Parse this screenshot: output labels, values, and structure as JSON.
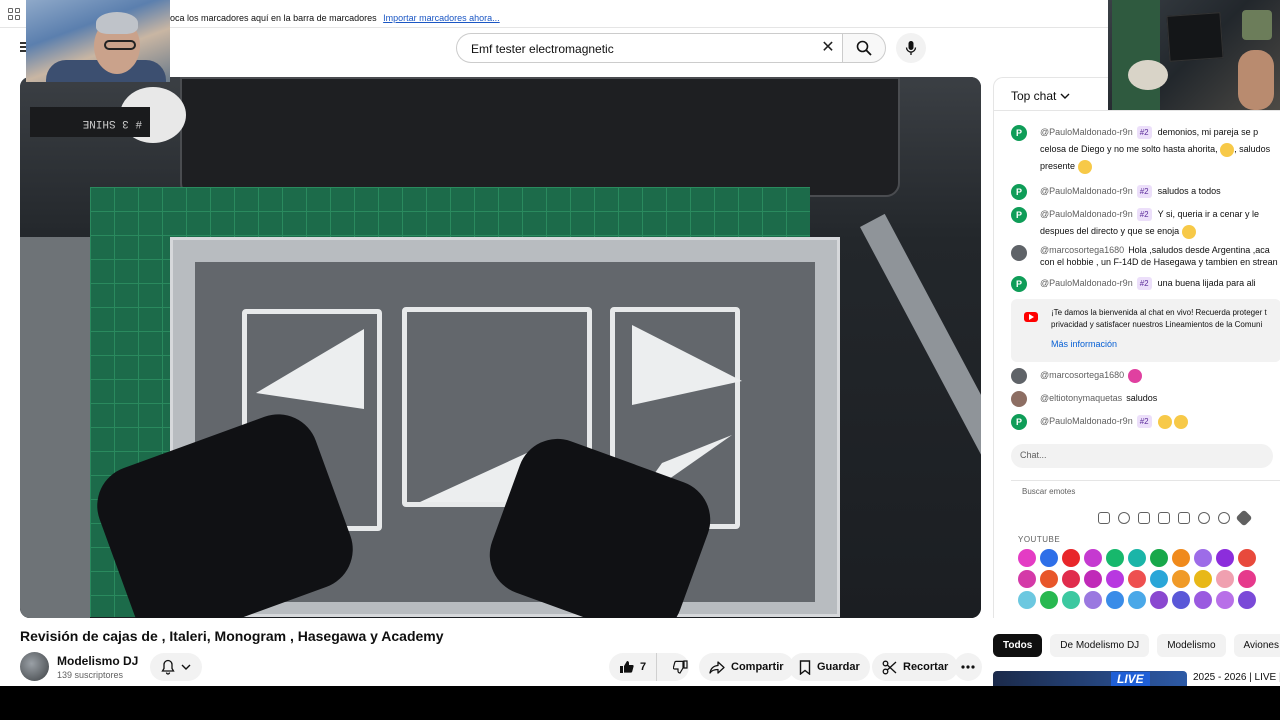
{
  "bookmarks_bar": {
    "message": "oca los marcadores aquí en la barra de marcadores",
    "import_link": "Importar marcadores ahora..."
  },
  "search": {
    "query": "Emf tester electromagnetic"
  },
  "video": {
    "title": "Revisión de cajas de , Italeri, Monogram , Hasegawa y Academy",
    "box_label": "# 3 SHINE"
  },
  "channel": {
    "name": "Modelismo DJ",
    "subscribers": "139 suscriptores"
  },
  "actions": {
    "like_count": "7",
    "share": "Compartir",
    "save": "Guardar",
    "clip": "Recortar"
  },
  "chat": {
    "header": "Top chat",
    "messages": [
      {
        "avatar": "P",
        "color": "#0f9d58",
        "author": "@PauloMaldonado-r9n",
        "badge": "#2",
        "text": "demonios, mi pareja se p"
      },
      {
        "avatar": "",
        "color": "",
        "author": "",
        "badge": "",
        "text": "celosa de Diego y no me solto hasta ahorita,",
        "text_after": ", saludos"
      },
      {
        "avatar": "",
        "color": "",
        "author": "",
        "badge": "",
        "text": "presente"
      },
      {
        "avatar": "P",
        "color": "#0f9d58",
        "author": "@PauloMaldonado-r9n",
        "badge": "#2",
        "text": "saludos a todos"
      },
      {
        "avatar": "P",
        "color": "#0f9d58",
        "author": "@PauloMaldonado-r9n",
        "badge": "#2",
        "text": "Y si, queria ir a cenar y le"
      },
      {
        "avatar": "",
        "color": "",
        "author": "",
        "badge": "",
        "text": "despues del directo y que se enoja"
      },
      {
        "avatar": "",
        "color": "#5f6368",
        "author": "@marcosortega1680",
        "badge": "",
        "text": "Hola ,saludos desde Argentina ,aca"
      },
      {
        "avatar": "",
        "color": "",
        "author": "",
        "badge": "",
        "text": "con el hobbie , un F-14D de Hasegawa y tambien en strean"
      },
      {
        "avatar": "P",
        "color": "#0f9d58",
        "author": "@PauloMaldonado-r9n",
        "badge": "#2",
        "text": "una buena lijada para ali"
      }
    ],
    "welcome": {
      "line1": "¡Te damos la bienvenida al chat en vivo! Recuerda proteger t",
      "line2": "privacidad y satisfacer nuestros Lineamientos de la Comuni",
      "link": "Más información"
    },
    "messages_after": [
      {
        "avatar": "",
        "color": "#5f6368",
        "author": "@marcosortega1680",
        "badge": "",
        "text": ""
      },
      {
        "avatar": "",
        "color": "#8d6e63",
        "author": "@eltiotonymaquetas",
        "badge": "",
        "text": "saludos"
      },
      {
        "avatar": "P",
        "color": "#0f9d58",
        "author": "@PauloMaldonado-r9n",
        "badge": "#2",
        "text": ""
      }
    ],
    "input_placeholder": "Chat...",
    "emote_search": "Buscar emotes",
    "emote_section": "YOUTUBE"
  },
  "chips": [
    "Todos",
    "De Modelismo DJ",
    "Modelismo",
    "Aviones de"
  ],
  "recommendation": {
    "badge": "LIVE",
    "title": "2025 - 2026 | LIVE |"
  }
}
